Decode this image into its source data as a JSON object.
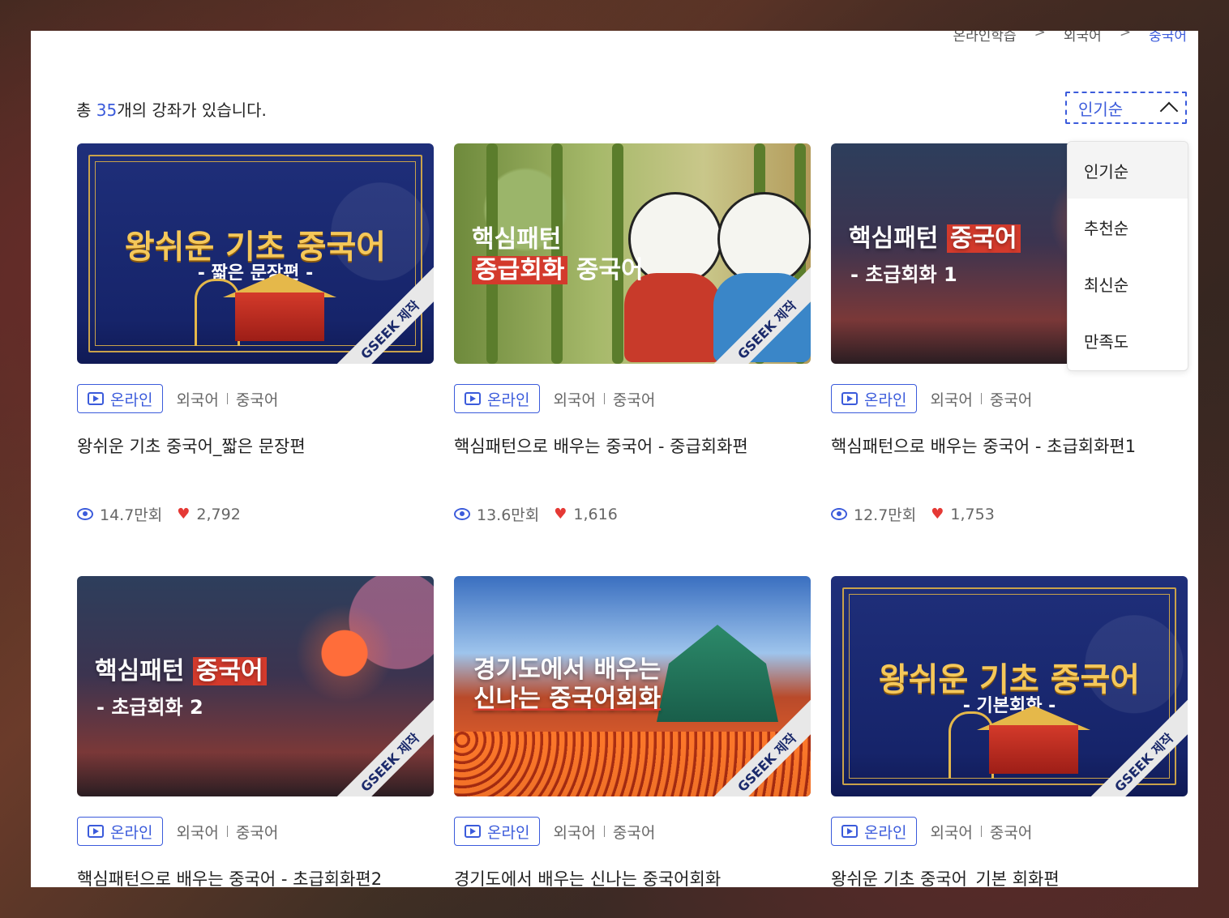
{
  "breadcrumb": [
    "온라인학습",
    "외국어",
    "중국어"
  ],
  "breadcrumb_sep": ">",
  "total": {
    "prefix": "총 ",
    "count": "35",
    "suffix": "개의 강좌가 있습니다."
  },
  "sort": {
    "selected": "인기순",
    "options": [
      "인기순",
      "추천순",
      "최신순",
      "만족도"
    ]
  },
  "badge_label": "온라인",
  "category": {
    "main": "외국어",
    "sub": "중국어"
  },
  "ribbon": "GSEEK 제작",
  "courses": [
    {
      "thumb_title": "왕쉬운 기초 중국어",
      "thumb_sub": "- 짧은 문장편 -",
      "title": "왕쉬운 기초 중국어_짧은 문장편",
      "views": "14.7만회",
      "likes": "2,792"
    },
    {
      "thumb_title_1": "핵심패턴",
      "thumb_title_2a": "중급회화",
      "thumb_title_2b": " 중국어",
      "title": "핵심패턴으로 배우는 중국어 - 중급회화편",
      "views": "13.6만회",
      "likes": "1,616"
    },
    {
      "thumb_title_a": "핵심패턴 ",
      "thumb_title_b": "중국어",
      "thumb_sub": "- 초급회화 1",
      "title": "핵심패턴으로 배우는 중국어 - 초급회화편1",
      "views": "12.7만회",
      "likes": "1,753"
    },
    {
      "thumb_title_a": "핵심패턴 ",
      "thumb_title_b": "중국어",
      "thumb_sub": "- 초급회화 2",
      "title": "핵심패턴으로 배우는 중국어 - 초급회화편2"
    },
    {
      "thumb_title_1": "경기도에서 배우는",
      "thumb_title_2": "신나는 중국어회화",
      "title": "경기도에서 배우는 신나는 중국어회화"
    },
    {
      "thumb_title": "왕쉬운 기초 중국어",
      "thumb_sub": "- 기본회화 -",
      "title": "왕쉬운 기초 중국어_기본 회화편"
    }
  ],
  "colors": {
    "accent": "#3b5bdb",
    "heart": "#e53935",
    "highlight": "#d33a2c"
  }
}
